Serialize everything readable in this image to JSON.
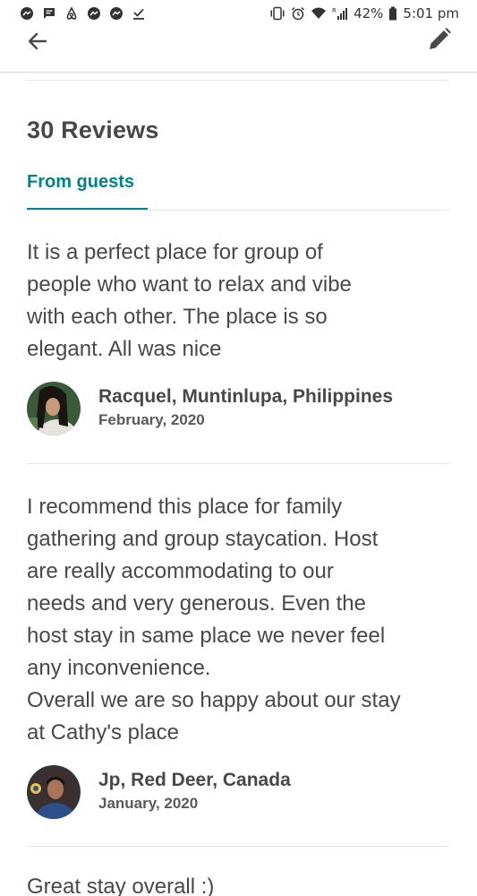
{
  "status_bar": {
    "battery": "42%",
    "time": "5:01 pm",
    "signal_label": "R",
    "left_icons": [
      "messenger-icon",
      "message-icon",
      "airbnb-icon",
      "messenger-icon",
      "messenger-icon",
      "download-done-icon"
    ],
    "right_icons": [
      "vibrate-icon",
      "alarm-icon",
      "wifi-icon",
      "signal-icon",
      "battery-icon"
    ]
  },
  "header": {
    "back_icon": "arrow-left-icon",
    "edit_icon": "pencil-icon"
  },
  "reviews": {
    "title": "30 Reviews",
    "tab_label": "From guests",
    "items": [
      {
        "text": "It is a perfect place for group of\npeople who want to relax and vibe\nwith each other. The place is so\nelegant. All was nice",
        "name": "Racquel, Muntinlupa, Philippines",
        "date": "February, 2020"
      },
      {
        "text": "I recommend this place for family\ngathering and group staycation. Host\nare really accommodating to our\nneeds and very generous. Even the\nhost stay in same place we never feel\nany inconvenience.\nOverall we are so happy about our stay\nat Cathy's place",
        "name": "Jp, Red Deer, Canada",
        "date": "January, 2020"
      },
      {
        "text": "Great stay overall :)"
      }
    ]
  },
  "colors": {
    "accent": "#008489",
    "text": "#484848",
    "divider": "#e4e4e4"
  }
}
